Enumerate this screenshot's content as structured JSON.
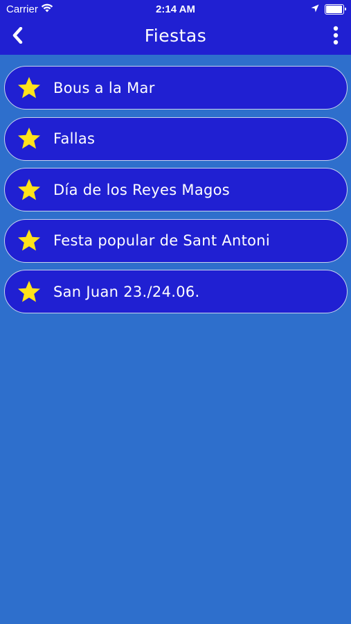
{
  "status_bar": {
    "carrier": "Carrier",
    "time": "2:14 AM",
    "battery_level": 0.95
  },
  "nav": {
    "title": "Fiestas",
    "back_icon": "chevron-left-icon",
    "more_icon": "vertical-ellipsis-icon"
  },
  "items": [
    {
      "label": "Bous a la Mar",
      "icon": "star-icon"
    },
    {
      "label": "Fallas",
      "icon": "star-icon"
    },
    {
      "label": "Día de los Reyes Magos",
      "icon": "star-icon"
    },
    {
      "label": "Festa popular de Sant Antoni",
      "icon": "star-icon"
    },
    {
      "label": "San Juan 23./24.06.",
      "icon": "star-icon"
    }
  ],
  "colors": {
    "background": "#2e6fcc",
    "bar": "#2020d2",
    "item_fill": "#2020d2",
    "item_border": "#c8d3ee",
    "star": "#ffe31a"
  }
}
